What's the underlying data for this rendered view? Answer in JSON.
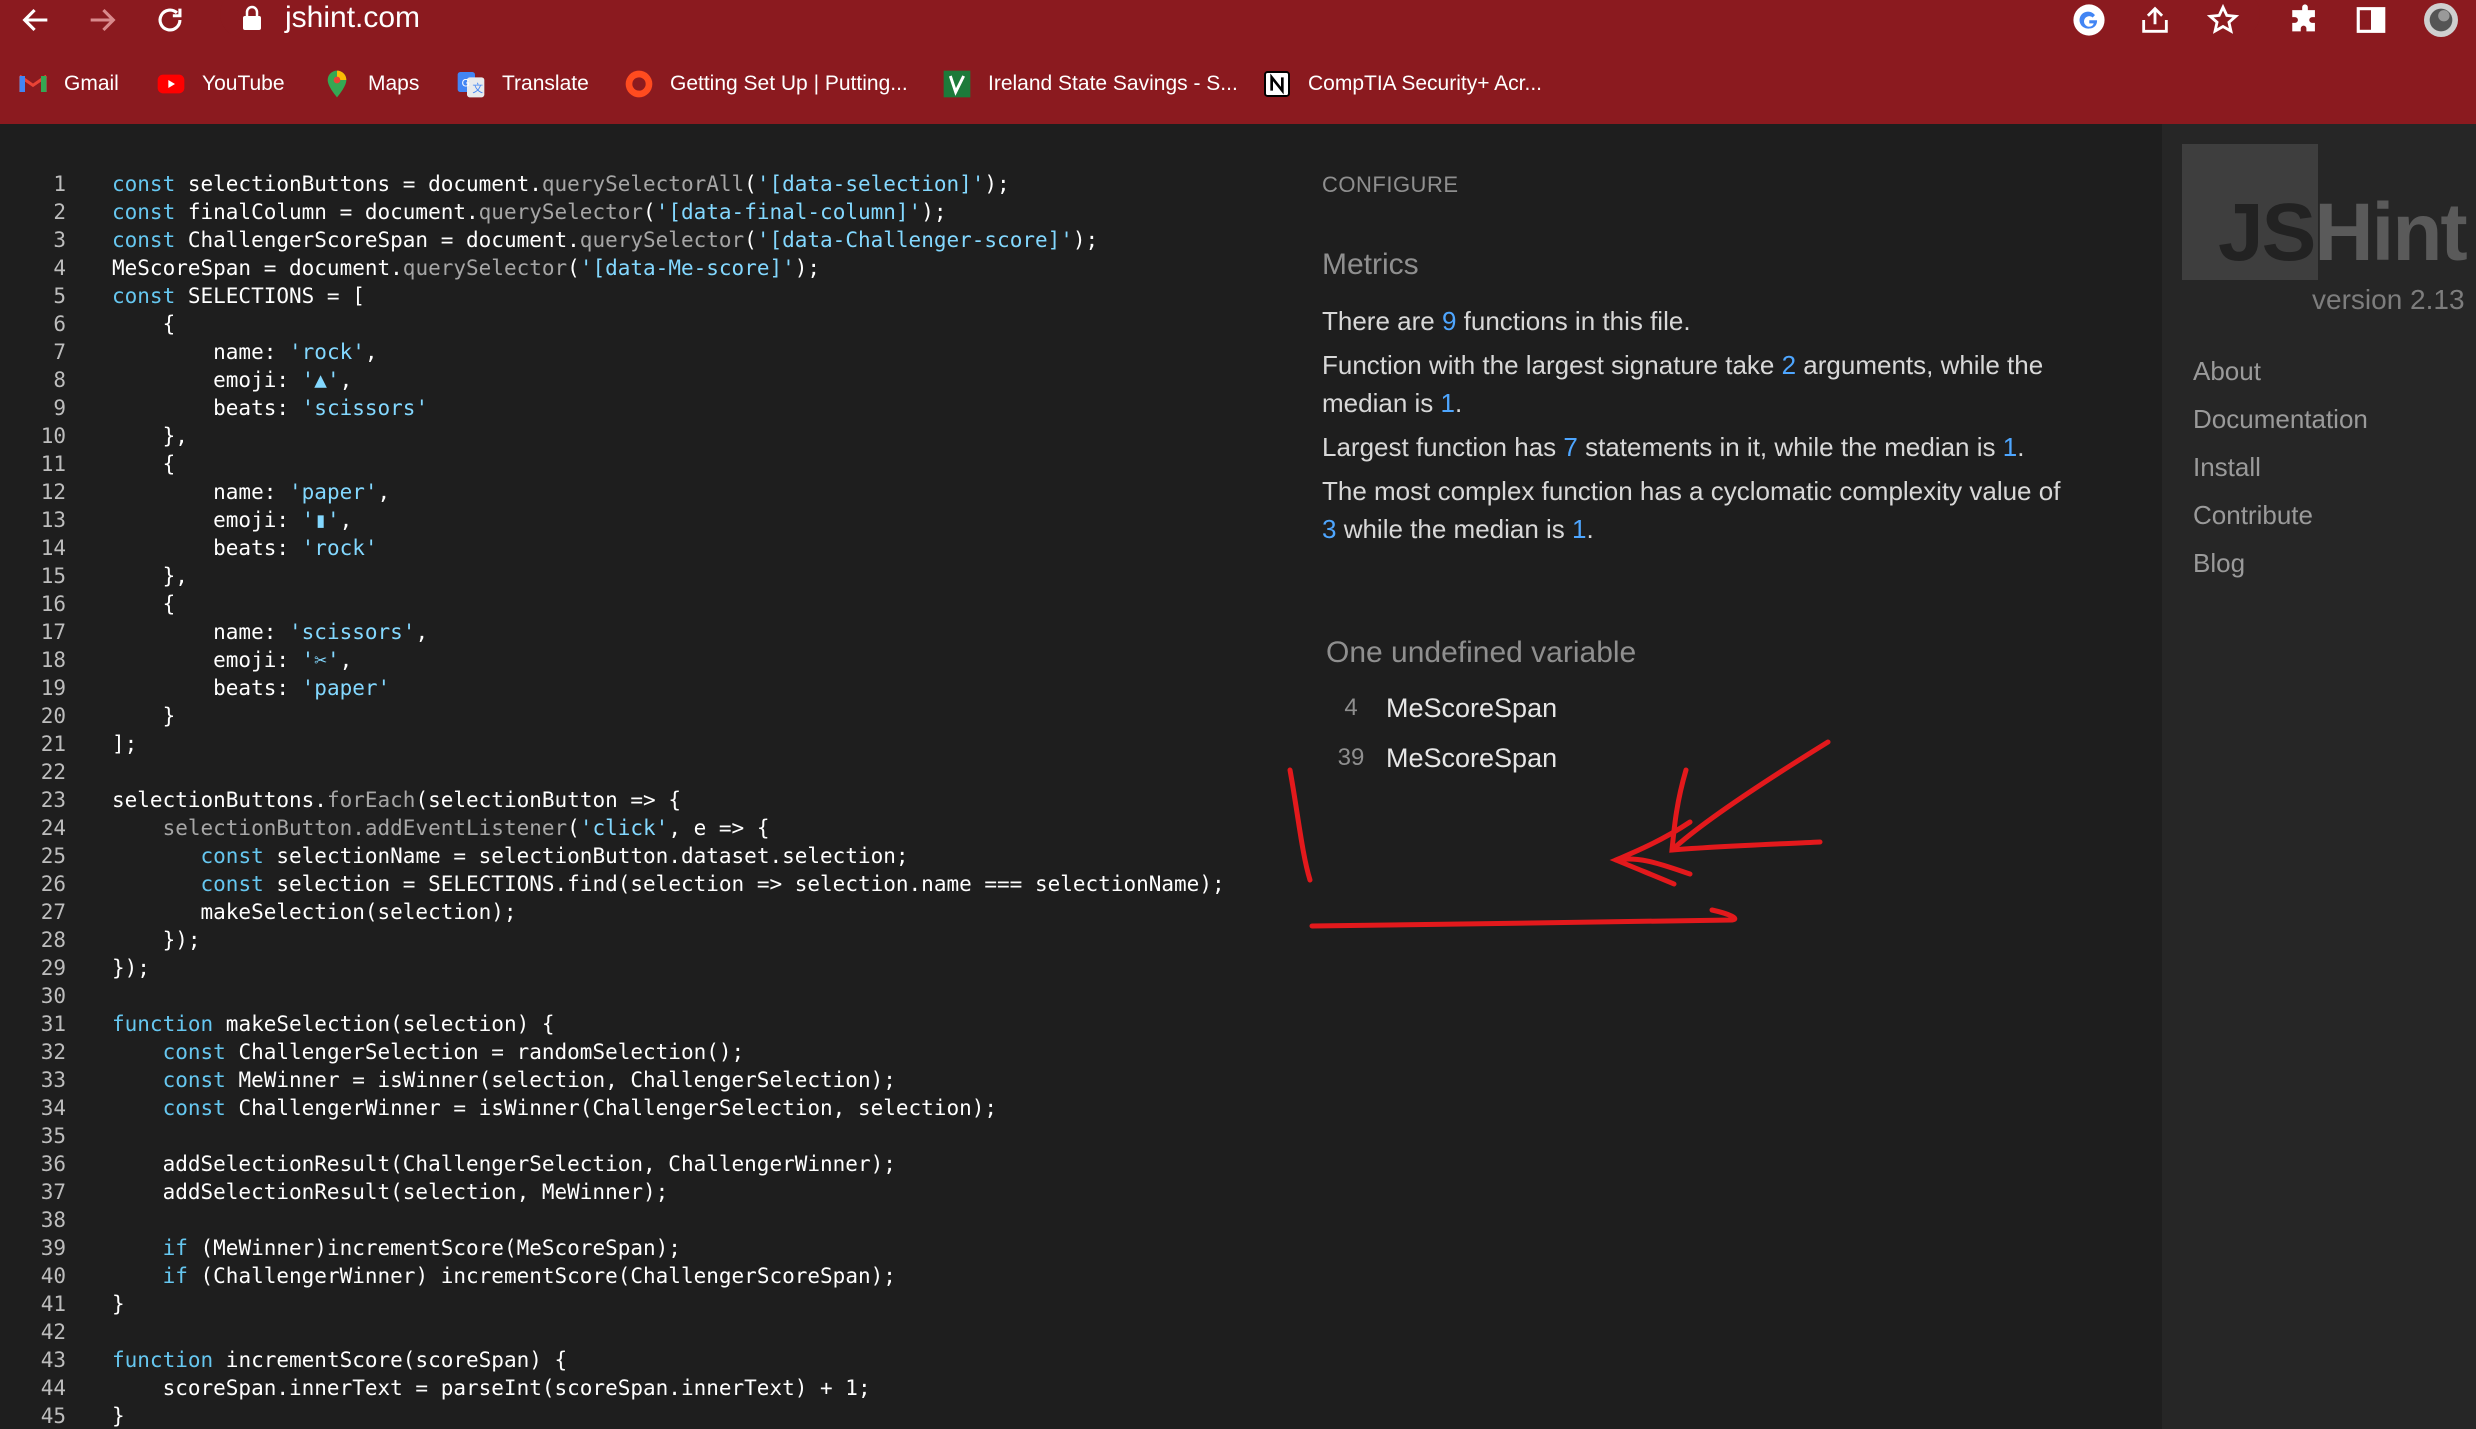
{
  "browser": {
    "url": "jshint.com",
    "bookmarks": [
      {
        "label": "Gmail",
        "icon": "gmail-icon"
      },
      {
        "label": "YouTube",
        "icon": "youtube-icon"
      },
      {
        "label": "Maps",
        "icon": "maps-icon"
      },
      {
        "label": "Translate",
        "icon": "translate-icon"
      },
      {
        "label": "Getting Set Up | Putting...",
        "icon": "circle-logo-icon"
      },
      {
        "label": "Ireland State Savings - S...",
        "icon": "state-savings-icon"
      },
      {
        "label": "CompTIA Security+ Acr...",
        "icon": "notion-icon"
      }
    ],
    "theme_color": "#8b1a1f"
  },
  "editor": {
    "line_numbers": [
      "1",
      "2",
      "3",
      "4",
      "5",
      "6",
      "7",
      "8",
      "9",
      "10",
      "11",
      "12",
      "13",
      "14",
      "15",
      "16",
      "17",
      "18",
      "19",
      "20",
      "21",
      "22",
      "23",
      "24",
      "25",
      "26",
      "27",
      "28",
      "29",
      "30",
      "31",
      "32",
      "33",
      "34",
      "35",
      "36",
      "37",
      "38",
      "39",
      "40",
      "41",
      "42",
      "43",
      "44",
      "45"
    ]
  },
  "report": {
    "configure_label": "CONFIGURE",
    "metrics_title": "Metrics",
    "functions": {
      "pre": "There are ",
      "num": "9",
      "post": " functions in this file."
    },
    "signature": {
      "pre": "Function with the largest signature take ",
      "num": "2",
      "mid": " arguments, while the median is ",
      "num2": "1",
      "post": "."
    },
    "statements": {
      "pre": "Largest function has ",
      "num": "7",
      "mid": " statements in it, while the median is ",
      "num2": "1",
      "post": "."
    },
    "complexity": {
      "pre": "The most complex function has a cyclomatic complexity value of ",
      "num": "3",
      "mid": " while the median is ",
      "num2": "1",
      "post": "."
    },
    "undefined_title": "One undefined variable",
    "undefined": [
      {
        "line": "4",
        "name": "MeScoreSpan"
      },
      {
        "line": "39",
        "name": "MeScoreSpan"
      }
    ],
    "number_color": "#4ea6ff"
  },
  "sidebar": {
    "logo_js": "JS",
    "logo_hint": "Hint",
    "version": "version 2.13",
    "links": [
      "About",
      "Documentation",
      "Install",
      "Contribute",
      "Blog"
    ]
  },
  "annotation_color": "#e3191c"
}
